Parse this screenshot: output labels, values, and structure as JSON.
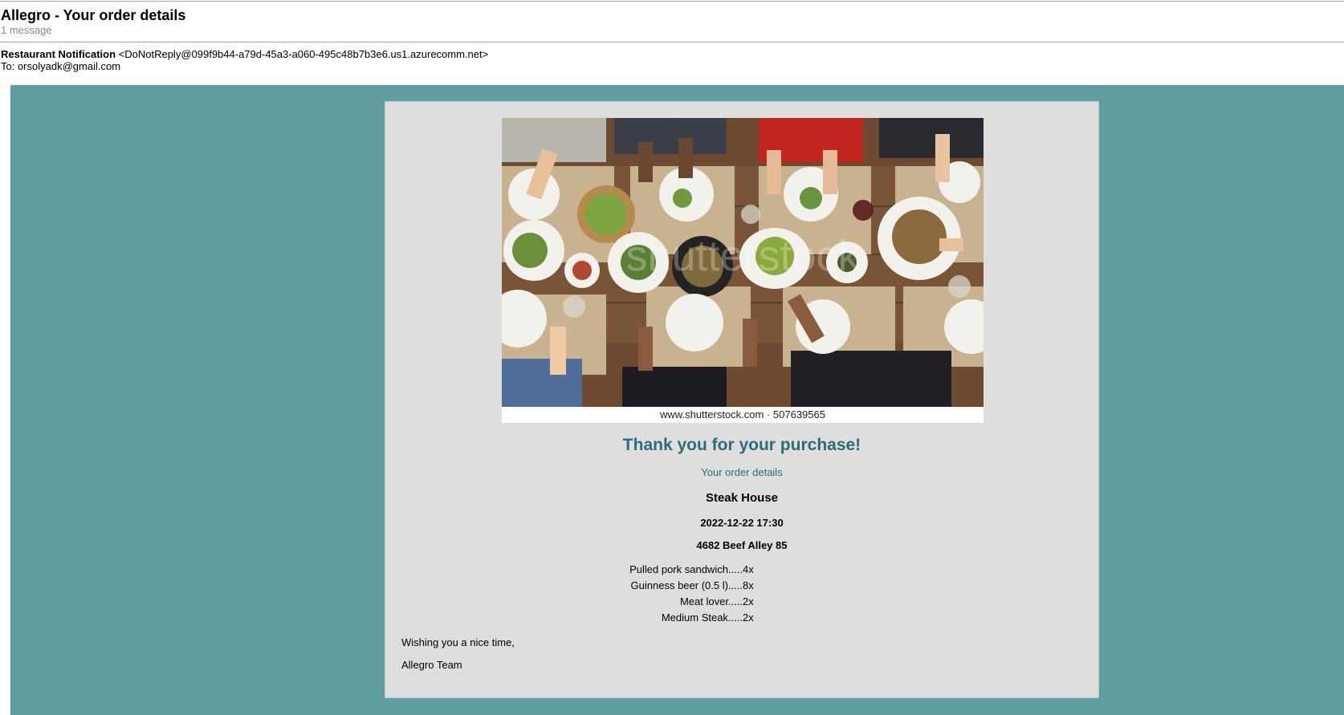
{
  "email": {
    "subject": "Allegro - Your order details",
    "message_count": "1 message",
    "sender_name": "Restaurant Notification",
    "sender_address": "<DoNotReply@099f9b44-a79d-45a3-a060-495c48b7b3e6.us1.azurecomm.net>",
    "recipient": "To: orsolyadk@gmail.com"
  },
  "content": {
    "image_credit": "www.shutterstock.com · 507639565",
    "thanks": "Thank you for your purchase!",
    "order_details_label": "Your order details",
    "restaurant": "Steak House",
    "datetime": "2022-12-22 17:30",
    "address": "4682 Beef Alley 85",
    "items": [
      {
        "name": "Pulled pork sandwich.....",
        "qty": "4x"
      },
      {
        "name": "Guinness beer (0.5 l).....",
        "qty": "8x"
      },
      {
        "name": "Meat lover.....",
        "qty": "2x"
      },
      {
        "name": "Medium Steak.....",
        "qty": "2x"
      }
    ],
    "closing": "Wishing you a nice time,",
    "signature": "Allegro Team"
  },
  "colors": {
    "teal_background": "#5f9ea0",
    "card_background": "#dedede",
    "heading": "#2e6b7a"
  }
}
